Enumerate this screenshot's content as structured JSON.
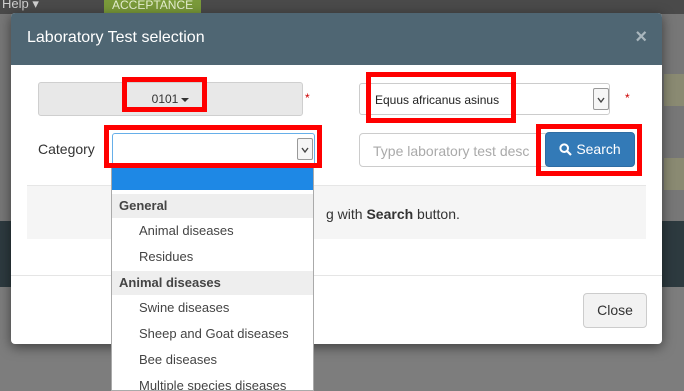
{
  "background": {
    "help_label": "Help ▾",
    "acceptance_label": "ACCEPTANCE"
  },
  "modal": {
    "title": "Laboratory Test selection",
    "close_x": "×",
    "laboratory_value": "0101",
    "required_marker": "*",
    "species_value": "Equus africanus asinus",
    "category_label": "Category",
    "category_value": "",
    "search_placeholder": "Type laboratory test desc",
    "search_button_label": "Search",
    "hint_prefix": "g with ",
    "hint_bold": "Search",
    "hint_suffix": " button.",
    "close_button_label": "Close"
  },
  "category_dropdown": {
    "groups": [
      {
        "label": "General",
        "items": [
          "Animal diseases",
          "Residues"
        ]
      },
      {
        "label": "Animal diseases",
        "items": [
          "Swine diseases",
          "Sheep and Goat diseases",
          "Bee diseases",
          "Multiple species diseases"
        ]
      }
    ]
  },
  "colors": {
    "header": "#4f6673",
    "primary": "#337ab7",
    "annotation": "#ff0000",
    "selected_option": "#1e88e5"
  }
}
